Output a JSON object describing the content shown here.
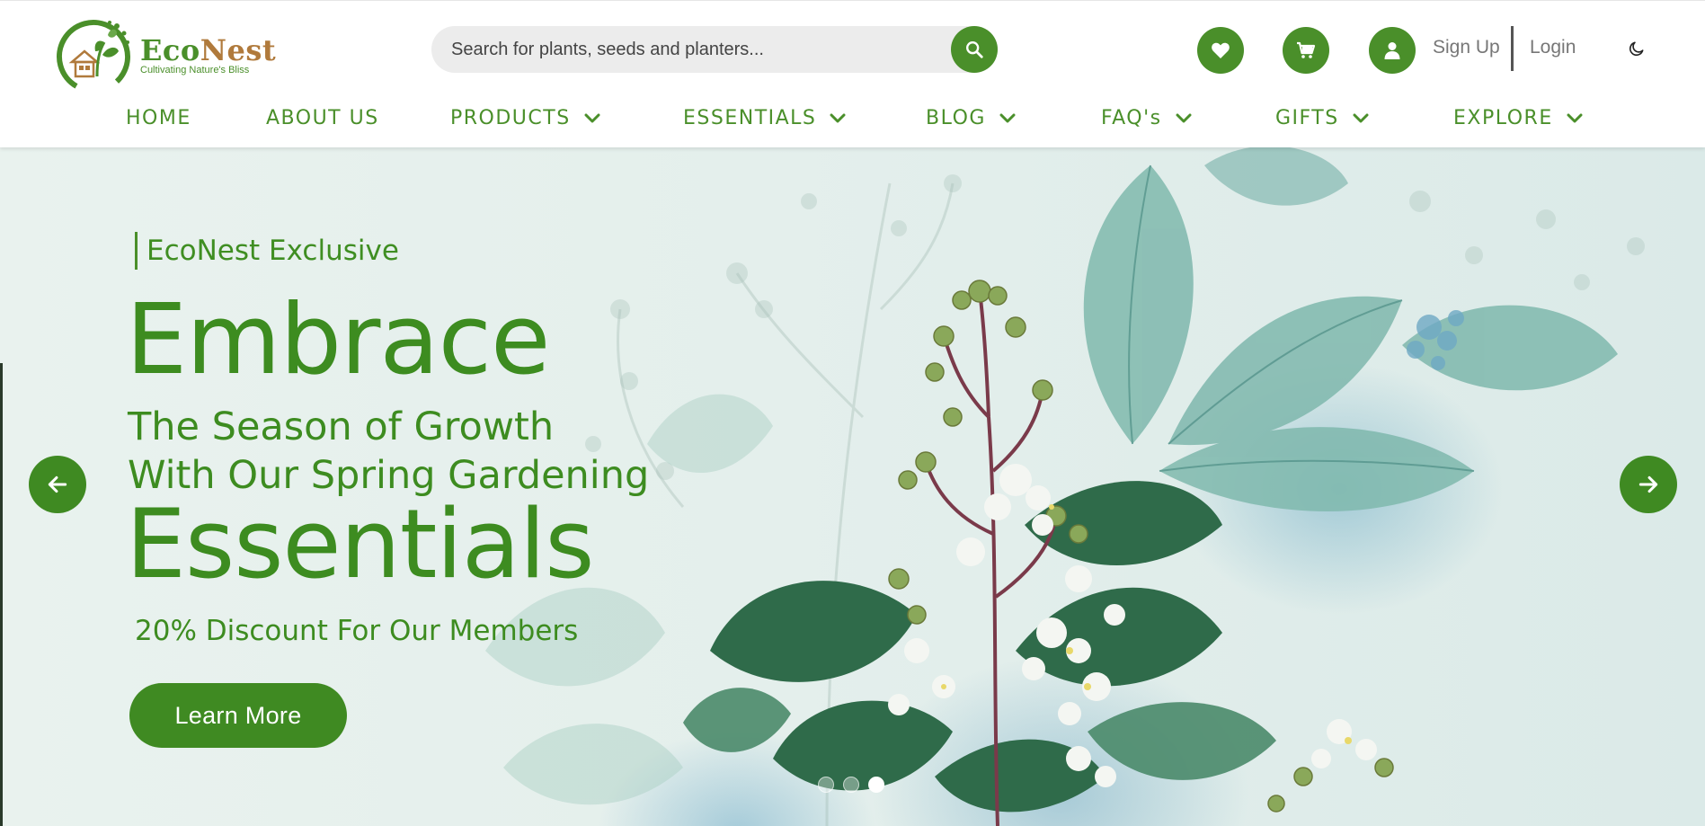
{
  "brand": {
    "name_part1": "Eco",
    "name_part2": "Nest",
    "tagline": "Cultivating Nature's Bliss"
  },
  "search": {
    "placeholder": "Search for plants, seeds and planters...",
    "icon": "search-icon"
  },
  "header_actions": {
    "wishlist_icon": "heart-icon",
    "cart_icon": "cart-icon",
    "user_icon": "user-icon",
    "signup_label": "Sign Up",
    "login_label": "Login",
    "theme_icon": "moon-icon"
  },
  "nav": {
    "items": [
      {
        "label": "HOME",
        "has_dropdown": false
      },
      {
        "label": "ABOUT US",
        "has_dropdown": false
      },
      {
        "label": "PRODUCTS",
        "has_dropdown": true
      },
      {
        "label": "ESSENTIALS",
        "has_dropdown": true
      },
      {
        "label": "BLOG",
        "has_dropdown": true
      },
      {
        "label": "FAQ's",
        "has_dropdown": true
      },
      {
        "label": "GIFTS",
        "has_dropdown": true
      },
      {
        "label": "EXPLORE",
        "has_dropdown": true
      }
    ]
  },
  "hero": {
    "kicker": "EcoNest Exclusive",
    "headline_1": "Embrace",
    "subline_1": "The Season of Growth",
    "subline_2": "With Our Spring Gardening",
    "headline_2": "Essentials",
    "discount": "20% Discount For Our Members",
    "cta_label": "Learn More",
    "prev_icon": "arrow-left-icon",
    "next_icon": "arrow-right-icon",
    "slides_total": 3,
    "active_slide": 3
  },
  "colors": {
    "brand_green": "#4a8f2a",
    "brand_brown": "#b07a3c",
    "hero_text": "#3d8c20"
  }
}
